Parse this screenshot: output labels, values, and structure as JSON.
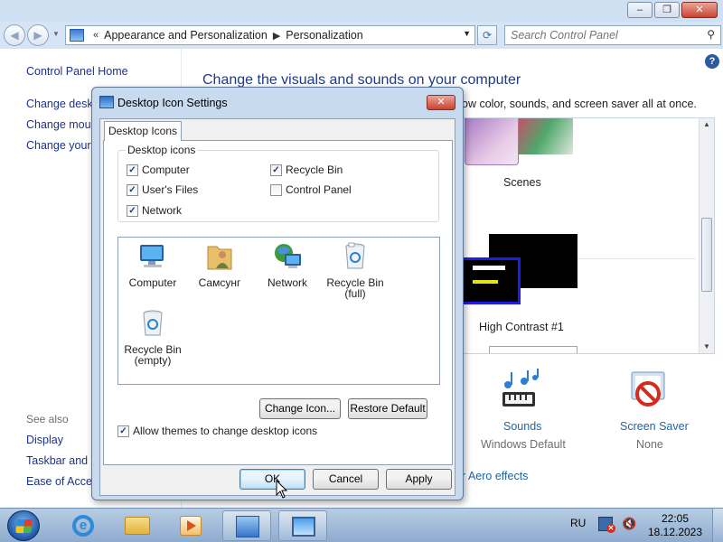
{
  "window": {
    "breadcrumb_prefix": "«",
    "breadcrumb": [
      "Appearance and Personalization",
      "Personalization"
    ],
    "search_placeholder": "Search Control Panel"
  },
  "leftpane": {
    "home": "Control Panel Home",
    "links": [
      "Change deskt",
      "Change mous",
      "Change your"
    ],
    "see_also": "See also",
    "see_also_links": [
      "Display",
      "Taskbar and S",
      "Ease of Acces"
    ]
  },
  "main": {
    "heading": "Change the visuals and sounds on your computer",
    "subtext": "ow color, sounds, and screen saver all at once.",
    "themes": [
      "Scenes",
      "High Contrast #1"
    ],
    "sounds": {
      "label": "Sounds",
      "value": "Windows Default"
    },
    "screensaver": {
      "label": "Screen Saver",
      "value": "None"
    },
    "aero_link": "r Aero effects"
  },
  "dialog": {
    "title": "Desktop Icon Settings",
    "tab": "Desktop Icons",
    "group_label": "Desktop icons",
    "checkboxes": [
      {
        "label": "Computer",
        "checked": true
      },
      {
        "label": "User's Files",
        "checked": true
      },
      {
        "label": "Network",
        "checked": true
      },
      {
        "label": "Recycle Bin",
        "checked": true
      },
      {
        "label": "Control Panel",
        "checked": false
      }
    ],
    "icons": [
      {
        "label": "Computer",
        "icon": "computer-icon"
      },
      {
        "label": "Самсунг",
        "icon": "user-folder-icon"
      },
      {
        "label": "Network",
        "icon": "network-icon"
      },
      {
        "label": "Recycle Bin (full)",
        "icon": "recycle-bin-full-icon"
      },
      {
        "label": "Recycle Bin (empty)",
        "icon": "recycle-bin-empty-icon"
      }
    ],
    "change_icon": "Change Icon...",
    "restore_default": "Restore Default",
    "allow_themes": {
      "label": "Allow themes to change desktop icons",
      "checked": true
    },
    "ok": "OK",
    "cancel": "Cancel",
    "apply": "Apply"
  },
  "taskbar": {
    "language": "RU",
    "time": "22:05",
    "date": "18.12.2023"
  }
}
